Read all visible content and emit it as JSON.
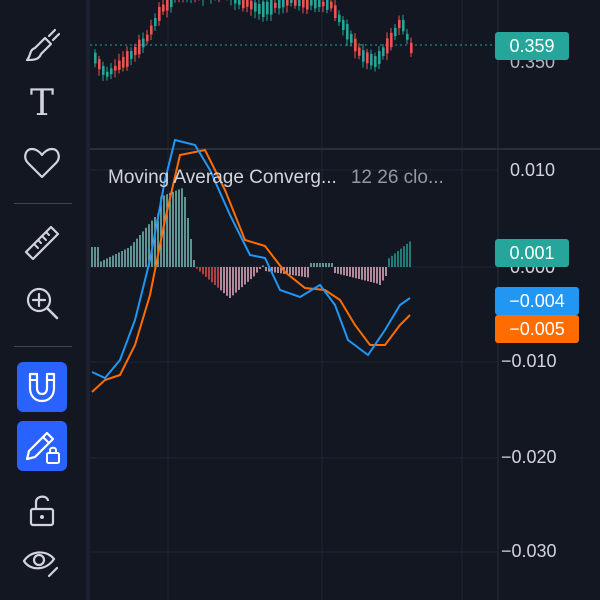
{
  "toolbar": {
    "tools": [
      {
        "name": "brush-icon",
        "active": false
      },
      {
        "name": "text-icon",
        "active": false
      },
      {
        "name": "heart-icon",
        "active": false
      },
      {
        "name": "ruler-icon",
        "active": false
      },
      {
        "name": "zoom-in-icon",
        "active": false
      },
      {
        "name": "magnet-icon",
        "active": true
      },
      {
        "name": "pencil-lock-icon",
        "active": true
      },
      {
        "name": "unlock-icon",
        "active": false
      },
      {
        "name": "eye-icon",
        "active": false
      }
    ],
    "text_tool_glyph": "T"
  },
  "price_pane": {
    "current_price": "0.359",
    "current_price_color": "#26a69a",
    "axis_label_partial": "0.350"
  },
  "indicator": {
    "title": "Moving Average Converg...",
    "params": "12 26 clo...",
    "axis_labels": [
      "0.010",
      "0.000",
      "−0.010",
      "−0.020",
      "−0.030"
    ],
    "histogram_value": "0.001",
    "histogram_color": "#26a69a",
    "macd_value": "−0.004",
    "macd_color": "#2196f3",
    "signal_value": "−0.005",
    "signal_color": "#ff6d00"
  }
}
